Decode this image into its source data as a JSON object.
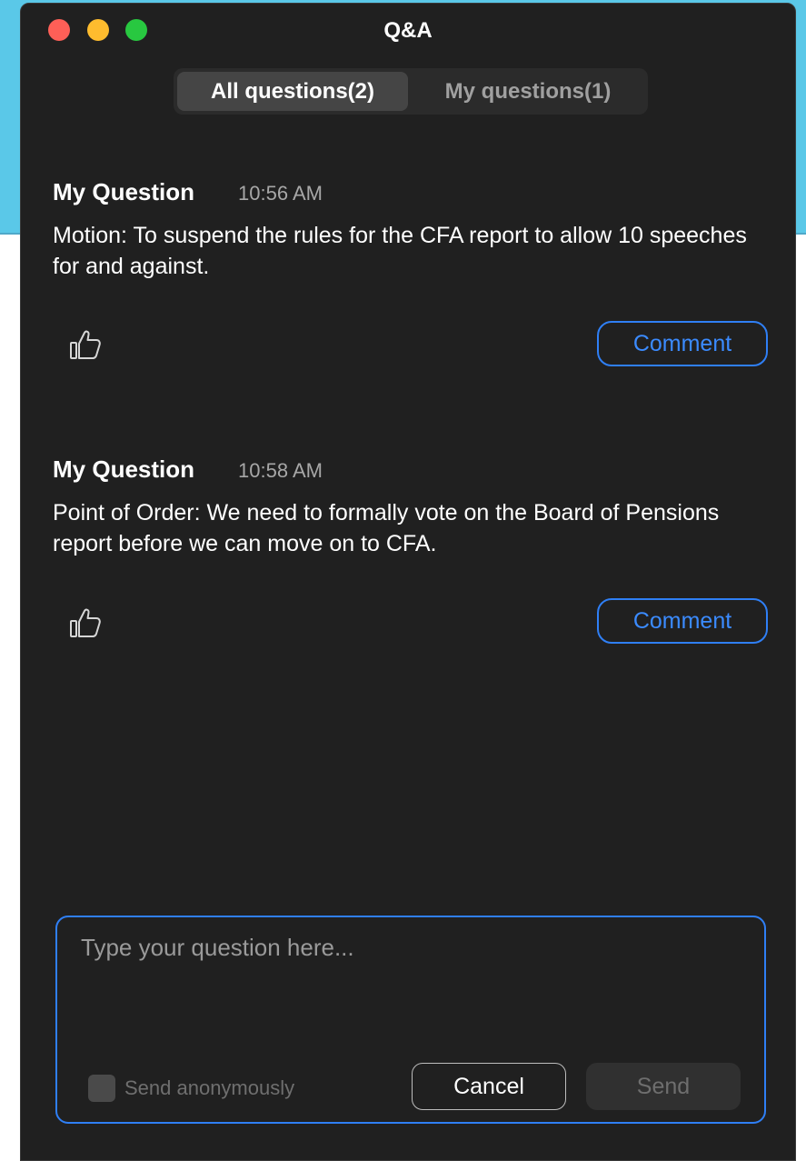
{
  "window": {
    "title": "Q&A"
  },
  "tabs": [
    {
      "label": "All questions(2)",
      "active": true
    },
    {
      "label": "My questions(1)",
      "active": false
    }
  ],
  "questions": [
    {
      "author": "My Question",
      "time": "10:56 AM",
      "text": "Motion: To suspend the rules for the CFA report to allow 10 speeches for and against.",
      "like_icon": "thumbs-up-icon",
      "comment_label": "Comment"
    },
    {
      "author": "My Question",
      "time": "10:58 AM",
      "text": "Point of Order: We need to formally vote on the Board of Pensions report before we can move on to CFA.",
      "like_icon": "thumbs-up-icon",
      "comment_label": "Comment"
    }
  ],
  "composer": {
    "placeholder": "Type your question here...",
    "value": "",
    "anonymous_label": "Send anonymously",
    "anonymous_checked": false,
    "cancel_label": "Cancel",
    "send_label": "Send"
  },
  "colors": {
    "window_bg": "#202020",
    "accent": "#2f7ff5",
    "backdrop": "#5ac8e8",
    "traffic_close": "#fe5f57",
    "traffic_minimize": "#febc2e",
    "traffic_maximize": "#28c840"
  }
}
